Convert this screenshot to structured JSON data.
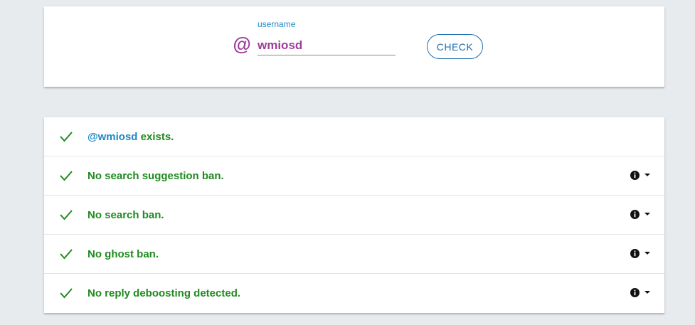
{
  "search": {
    "at_symbol": "@",
    "label": "username",
    "value": "wmiosd",
    "check_label": "CHECK"
  },
  "results": {
    "exists": {
      "handle": "@wmiosd",
      "text": " exists."
    },
    "items": [
      {
        "label": "No search suggestion ban."
      },
      {
        "label": "No search ban."
      },
      {
        "label": "No ghost ban."
      },
      {
        "label": "No reply deboosting detected."
      }
    ]
  },
  "icons": {
    "status": "check-icon",
    "info": "info-icon",
    "expand": "caret-down-icon"
  },
  "colors": {
    "background": "#e7ebee",
    "accent_blue": "#1e88c7",
    "username_purple": "#9c3e9a",
    "success_green": "#1f8a1f"
  }
}
